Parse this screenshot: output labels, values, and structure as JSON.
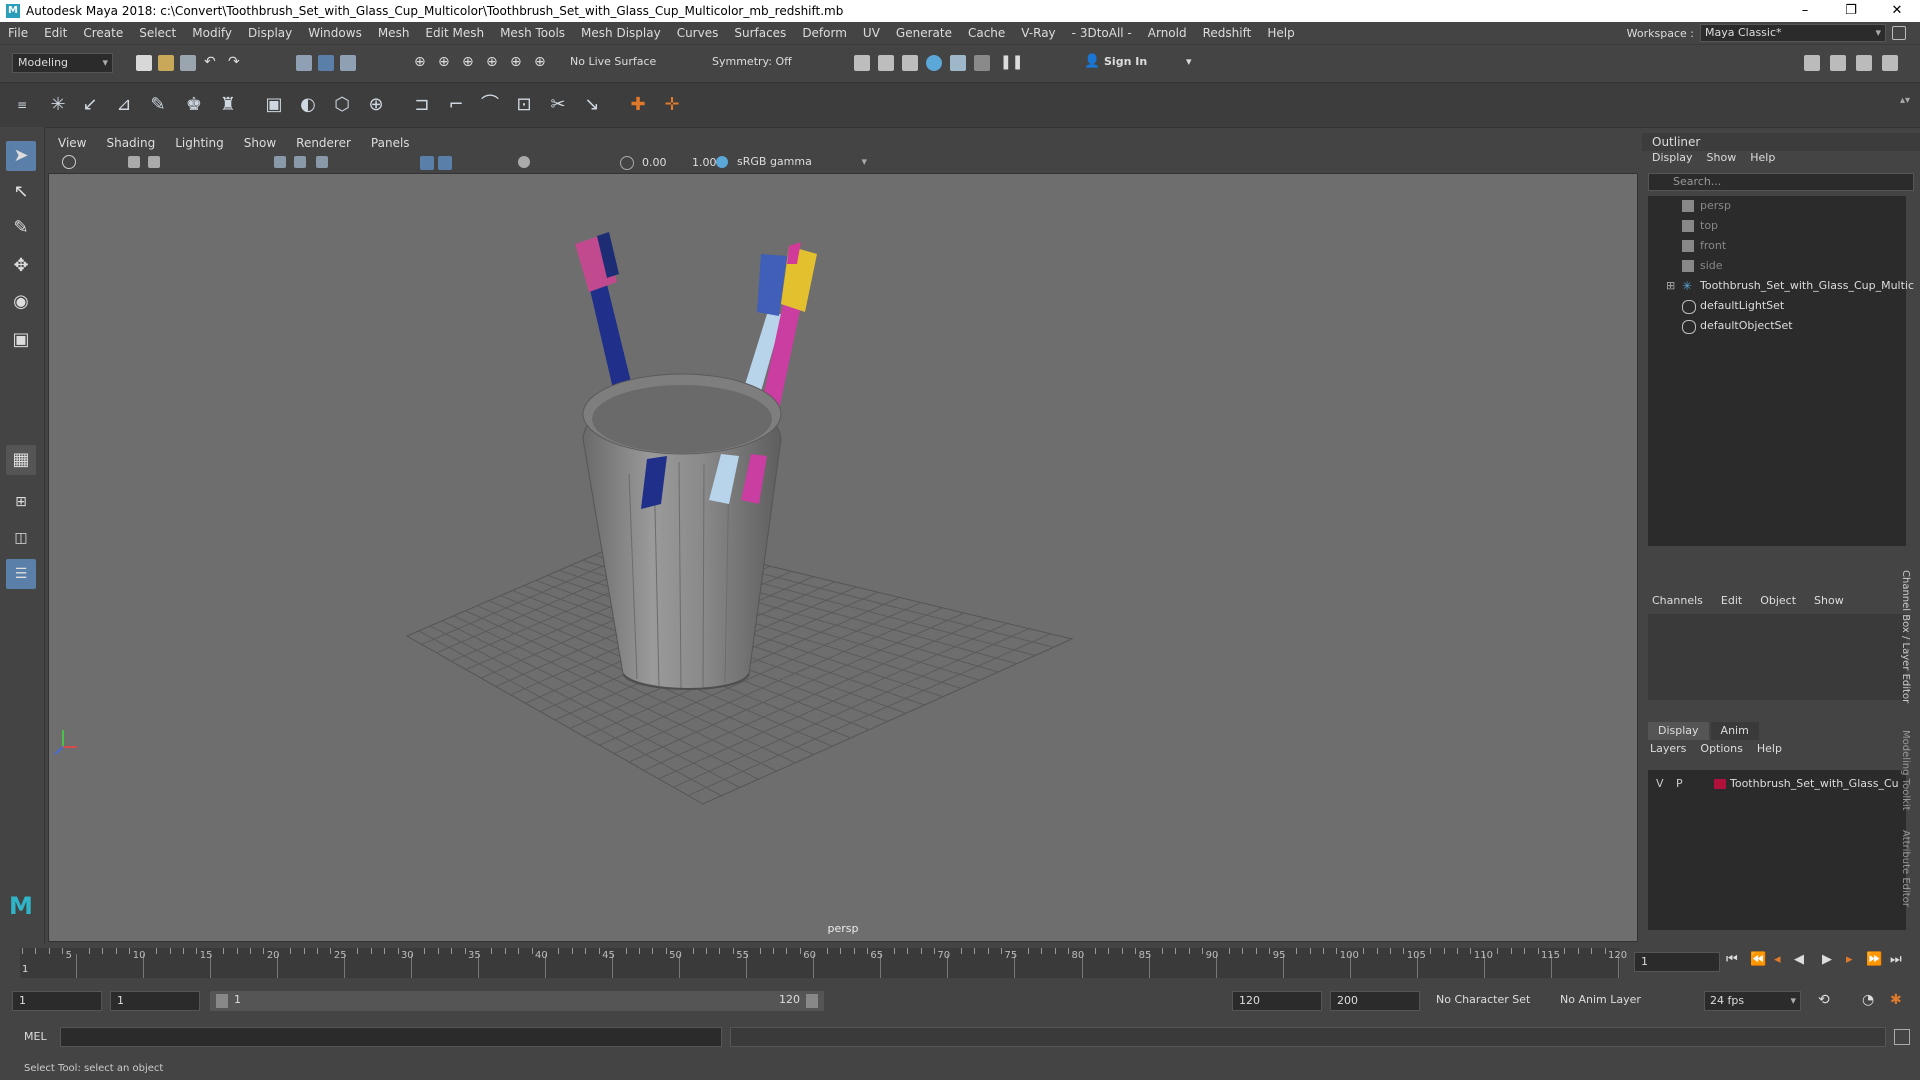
{
  "window": {
    "logo_letter": "M",
    "title": "Autodesk Maya 2018: c:\\Convert\\Toothbrush_Set_with_Glass_Cup_Multicolor\\Toothbrush_Set_with_Glass_Cup_Multicolor_mb_redshift.mb",
    "minimize": "–",
    "maximize": "❐",
    "close": "✕"
  },
  "menubar": {
    "items": [
      "File",
      "Edit",
      "Create",
      "Select",
      "Modify",
      "Display",
      "Windows",
      "Mesh",
      "Edit Mesh",
      "Mesh Tools",
      "Mesh Display",
      "Curves",
      "Surfaces",
      "Deform",
      "UV",
      "Generate",
      "Cache",
      "V-Ray",
      "- 3DtoAll -",
      "Arnold",
      "Redshift",
      "Help"
    ],
    "workspace_label": "Workspace :",
    "workspace_value": "Maya Classic*"
  },
  "statusline": {
    "mode": "Modeling",
    "live_surface": "No Live Surface",
    "symmetry": "Symmetry: Off",
    "sign_in": "Sign In"
  },
  "viewport": {
    "menus": [
      "View",
      "Shading",
      "Lighting",
      "Show",
      "Renderer",
      "Panels"
    ],
    "exposure": "0.00",
    "gamma": "1.00",
    "color_space": "sRGB gamma",
    "camera_label": "persp"
  },
  "outliner": {
    "title": "Outliner",
    "menus": [
      "Display",
      "Show",
      "Help"
    ],
    "search_placeholder": "Search...",
    "items": [
      {
        "label": "persp",
        "type": "camera",
        "dim": true
      },
      {
        "label": "top",
        "type": "camera",
        "dim": true
      },
      {
        "label": "front",
        "type": "camera",
        "dim": true
      },
      {
        "label": "side",
        "type": "camera",
        "dim": true
      },
      {
        "label": "Toothbrush_Set_with_Glass_Cup_Multic",
        "type": "group",
        "dim": false
      },
      {
        "label": "defaultLightSet",
        "type": "set",
        "dim": false
      },
      {
        "label": "defaultObjectSet",
        "type": "set",
        "dim": false
      }
    ]
  },
  "channelbox": {
    "menus": [
      "Channels",
      "Edit",
      "Object",
      "Show"
    ],
    "side_tabs": [
      "Channel Box / Layer Editor",
      "Modeling Toolkit",
      "Attribute Editor"
    ]
  },
  "layers": {
    "tabs": [
      "Display",
      "Anim"
    ],
    "menus": [
      "Layers",
      "Options",
      "Help"
    ],
    "row": {
      "v": "V",
      "p": "P",
      "color": "#b0103a",
      "name": "Toothbrush_Set_with_Glass_Cu"
    }
  },
  "timeline": {
    "labels": [
      "5",
      "10",
      "15",
      "20",
      "25",
      "30",
      "35",
      "40",
      "45",
      "50",
      "55",
      "60",
      "65",
      "70",
      "75",
      "80",
      "85",
      "90",
      "95",
      "100",
      "105",
      "110",
      "115",
      "120"
    ],
    "start_marker": "1",
    "current_frame": "1"
  },
  "range": {
    "start": "1",
    "playback_start": "1",
    "slider_start": "1",
    "slider_end": "120",
    "playback_end": "120",
    "end": "200",
    "character_set": "No Character Set",
    "anim_layer": "No Anim Layer",
    "fps": "24 fps"
  },
  "cmdline": {
    "label": "MEL"
  },
  "helpline": {
    "text": "Select Tool: select an object"
  }
}
